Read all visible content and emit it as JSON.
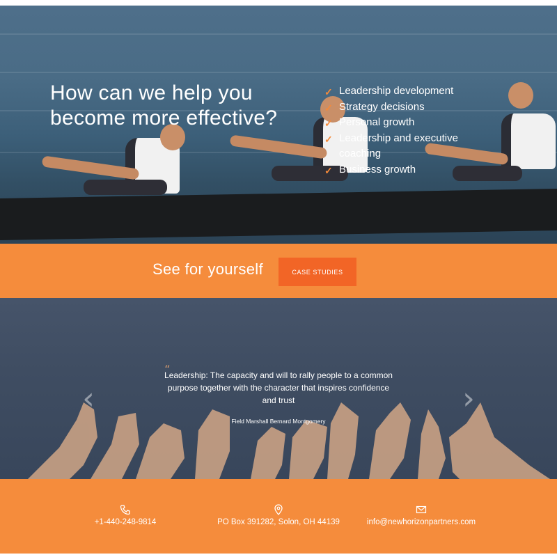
{
  "hero": {
    "title": "How can we help you become more effective?",
    "services": [
      "Leadership development",
      "Strategy decisions",
      "Personal growth",
      "Leadership and executive coaching",
      "Business growth"
    ]
  },
  "cta": {
    "text": "See for yourself",
    "button_label": "CASE STUDIES"
  },
  "quote": {
    "text": "Leadership: The capacity and will to rally people to a common purpose together with the character that inspires confidence and trust",
    "author": "Field Marshall Bernard Montgomery"
  },
  "footer": {
    "phone": "+1-440-248-9814",
    "address": "PO Box 391282, Solon, OH 44139",
    "email": "info@newhorizonpartners.com"
  },
  "colors": {
    "accent_orange": "#f58c3c",
    "button_orange": "#f26526",
    "check_orange": "#f58a3a",
    "quote_bg": "#3f4d62"
  },
  "icons": {
    "check": "check-icon",
    "phone": "phone-icon",
    "location": "location-pin-icon",
    "email": "envelope-icon",
    "prev": "chevron-left-icon",
    "next": "chevron-right-icon"
  }
}
